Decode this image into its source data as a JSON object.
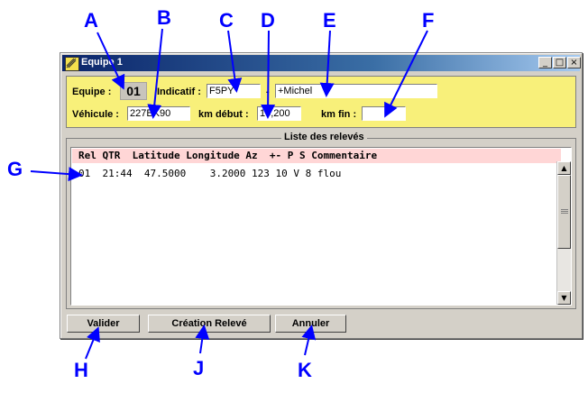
{
  "window": {
    "title": "Equipe 1",
    "controls": {
      "minimize": "_",
      "maximize": "□",
      "close": "×"
    }
  },
  "top_panel": {
    "equipe_label": "Equipe :",
    "equipe_value": "01",
    "indicatif_label": "Indicatif :",
    "indicatif_value": "F5PY",
    "separator": "-",
    "name_value": "+Michel",
    "vehicule_label": "Véhicule :",
    "vehicule_value": "227BK90",
    "km_debut_label": "km début :",
    "km_debut_value": "16,200",
    "km_fin_label": "km fin :",
    "km_fin_value": ""
  },
  "list": {
    "title": "Liste des relevés",
    "header": "Rel QTR  Latitude Longitude Az  +- P S Commentaire",
    "rows": [
      "01  21:44  47.5000    3.2000 123 10 V 8 flou"
    ]
  },
  "buttons": {
    "validate": "Valider",
    "create_reading": "Création Relevé",
    "cancel": "Annuler"
  },
  "annotations": [
    "A",
    "B",
    "C",
    "D",
    "E",
    "F",
    "G",
    "H",
    "J",
    "K"
  ],
  "colors": {
    "panel_yellow": "#f8f07a",
    "header_pink": "#ffd6d6",
    "annotation_blue": "#0000ff",
    "title_bar": "#0a246a"
  }
}
